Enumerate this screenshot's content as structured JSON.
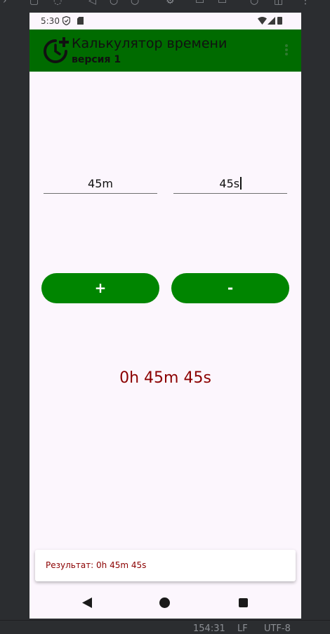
{
  "statusbar": {
    "time": "5:30"
  },
  "appbar": {
    "title": "Калькулятор времени",
    "subtitle": "версия 1"
  },
  "inputs": {
    "minutes_value": "45m",
    "seconds_value": "45s"
  },
  "buttons": {
    "add_label": "+",
    "subtract_label": "-"
  },
  "result": {
    "text": "0h 45m 45s"
  },
  "snackbar": {
    "text": "Результат: 0h 45m 45s"
  },
  "ide_status": {
    "position": "154:31",
    "line_ending": "LF",
    "encoding": "UTF-8"
  },
  "colors": {
    "appbar": "#006b00",
    "button": "#008500",
    "result_text": "#8b0000",
    "background": "#fcf6fd"
  },
  "icons": [
    "shield-icon",
    "sdcard-icon",
    "wifi-icon",
    "signal-icon",
    "battery-icon",
    "timer-add-icon",
    "overflow-menu-icon",
    "nav-back-icon",
    "nav-home-icon",
    "nav-recents-icon"
  ]
}
